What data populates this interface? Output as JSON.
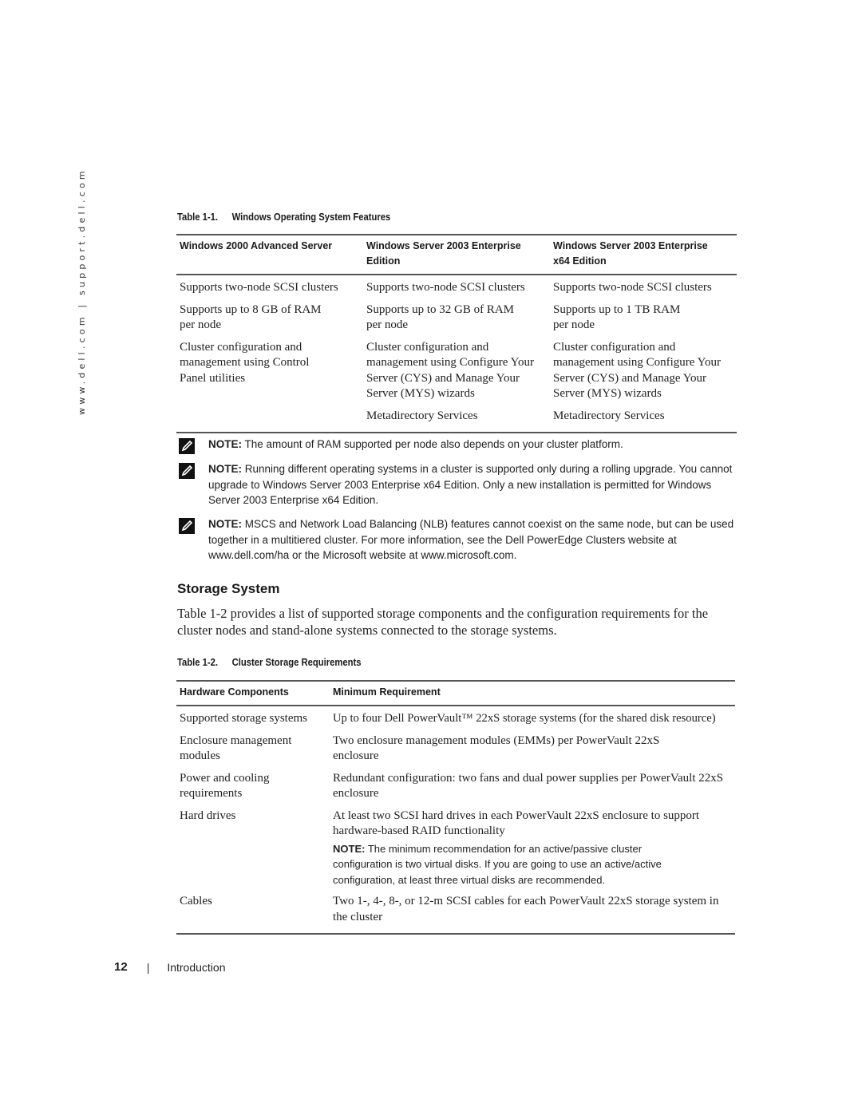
{
  "side_url": "www.dell.com | support.dell.com",
  "table1": {
    "caption_num": "Table 1-1.",
    "caption_title": "Windows Operating System Features",
    "headers": [
      "Windows 2000 Advanced Server",
      "Windows Server 2003 Enterprise Edition",
      "Windows Server 2003 Enterprise x64 Edition"
    ],
    "rows": [
      [
        "Supports two-node SCSI clusters",
        "Supports two-node SCSI clusters",
        "Supports two-node SCSI clusters"
      ],
      [
        "Supports up to 8 GB of RAM per node",
        "Supports up to 32 GB of RAM per node",
        "Supports up to 1 TB RAM per node"
      ],
      [
        "Cluster configuration and management using Control Panel utilities",
        "Cluster configuration and management using Configure Your Server (CYS) and Manage Your Server (MYS) wizards",
        "Cluster configuration and management using Configure Your Server (CYS) and Manage Your Server (MYS) wizards"
      ],
      [
        "",
        "Metadirectory Services",
        "Metadirectory Services"
      ]
    ]
  },
  "notes": [
    {
      "label": "NOTE:",
      "text": " The amount of RAM supported per node also depends on your cluster platform."
    },
    {
      "label": "NOTE:",
      "text": " Running different operating systems in a cluster is supported only during a rolling upgrade. You cannot upgrade to Windows Server 2003 Enterprise x64 Edition. Only a new installation is permitted for Windows Server 2003 Enterprise x64 Edition."
    },
    {
      "label": "NOTE:",
      "text": " MSCS and Network Load Balancing (NLB) features cannot coexist on the same node, but can be used together in a multitiered cluster. For more information, see the Dell PowerEdge Clusters website at ",
      "link1": "www.dell.com/ha",
      "mid": " or the Microsoft website at ",
      "link2": "www.microsoft.com",
      "end": "."
    }
  ],
  "section": {
    "heading": "Storage System",
    "paragraph": "Table 1-2 provides a list of supported storage components and the configuration requirements for the cluster nodes and stand-alone systems connected to the storage systems."
  },
  "table2": {
    "caption_num": "Table 1-2.",
    "caption_title": "Cluster Storage Requirements",
    "headers": [
      "Hardware Components",
      "Minimum Requirement"
    ],
    "rows": [
      [
        "Supported storage systems",
        "Up to four Dell PowerVault™ 22xS storage systems (for the shared disk resource)"
      ],
      [
        "Enclosure management modules",
        "Two enclosure management modules (EMMs) per PowerVault 22xS enclosure"
      ],
      [
        "Power and cooling requirements",
        "Redundant configuration: two fans and dual power supplies per PowerVault 22xS enclosure"
      ],
      [
        "Hard drives",
        "At least two SCSI hard drives in each PowerVault 22xS enclosure to support hardware-based RAID functionality"
      ],
      [
        "Cables",
        "Two 1-, 4-, 8-, or 12-m SCSI cables for each PowerVault 22xS storage system in the cluster"
      ]
    ],
    "hard_drives_note": {
      "label": "NOTE:",
      "text": " The minimum recommendation for an active/passive cluster configuration is two virtual disks. If you are going to use an active/active configuration, at least three virtual disks are recommended."
    }
  },
  "footer": {
    "page_number": "12",
    "separator": "|",
    "section_label": "Introduction"
  }
}
